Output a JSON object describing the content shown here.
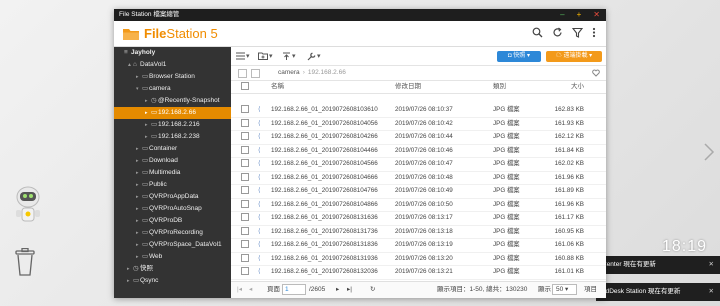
{
  "window": {
    "title": "File Station 檔案總管"
  },
  "app": {
    "logo_text_bold": "File",
    "logo_text_rest": "Station 5"
  },
  "colors": {
    "accent_orange": "#f08c00",
    "accent_blue": "#2d88d8",
    "sidebar_bg": "#333333",
    "selected_bg": "#e58b00"
  },
  "header_icons": [
    "search-icon",
    "refresh-icon",
    "filter-icon",
    "more-icon"
  ],
  "sidebar": {
    "items": [
      {
        "label": "Jayholy",
        "level": 0,
        "arrow": "",
        "icon": "≡",
        "selected": false,
        "head": true
      },
      {
        "label": "DataVol1",
        "level": 1,
        "arrow": "▲",
        "icon": "⌂",
        "selected": false
      },
      {
        "label": "Browser Station",
        "level": 2,
        "arrow": "▸",
        "icon": "▭",
        "selected": false
      },
      {
        "label": "camera",
        "level": 2,
        "arrow": "▾",
        "icon": "▭",
        "selected": false
      },
      {
        "label": "@Recently-Snapshot",
        "level": 3,
        "arrow": "▸",
        "icon": "◷",
        "selected": false
      },
      {
        "label": "192.168.2.66",
        "level": 3,
        "arrow": "▸",
        "icon": "▭",
        "selected": true
      },
      {
        "label": "192.168.2.216",
        "level": 3,
        "arrow": "▸",
        "icon": "▭",
        "selected": false
      },
      {
        "label": "192.168.2.238",
        "level": 3,
        "arrow": "▸",
        "icon": "▭",
        "selected": false
      },
      {
        "label": "Container",
        "level": 2,
        "arrow": "▸",
        "icon": "▭",
        "selected": false
      },
      {
        "label": "Download",
        "level": 2,
        "arrow": "▸",
        "icon": "▭",
        "selected": false
      },
      {
        "label": "Multimedia",
        "level": 2,
        "arrow": "▸",
        "icon": "▭",
        "selected": false
      },
      {
        "label": "Public",
        "level": 2,
        "arrow": "▸",
        "icon": "▭",
        "selected": false
      },
      {
        "label": "QVRProAppData",
        "level": 2,
        "arrow": "▸",
        "icon": "▭",
        "selected": false
      },
      {
        "label": "QVRProAutoSnap",
        "level": 2,
        "arrow": "▸",
        "icon": "▭",
        "selected": false
      },
      {
        "label": "QVRProDB",
        "level": 2,
        "arrow": "▸",
        "icon": "▭",
        "selected": false
      },
      {
        "label": "QVRProRecording",
        "level": 2,
        "arrow": "▸",
        "icon": "▭",
        "selected": false
      },
      {
        "label": "QVRProSpace_DataVol1",
        "level": 2,
        "arrow": "▸",
        "icon": "▭",
        "selected": false
      },
      {
        "label": "Web",
        "level": 2,
        "arrow": "▸",
        "icon": "▭",
        "selected": false
      },
      {
        "label": "快照",
        "level": 1,
        "arrow": "▸",
        "icon": "◷",
        "selected": false
      },
      {
        "label": "Qsync",
        "level": 1,
        "arrow": "▸",
        "icon": "▭",
        "selected": false
      }
    ]
  },
  "toolbar": {
    "snapshot_btn": "快照",
    "remote_mount_btn": "遠端掛載"
  },
  "path": {
    "root": "camera",
    "current": "192.168.2.66"
  },
  "columns": {
    "name": "名稱",
    "date": "修改日期",
    "type": "類別",
    "size": "大小"
  },
  "rows": [
    {
      "name": "192.168.2.66_01_2019072608103610",
      "date": "2019/07/26 08:10:37",
      "type": "JPG 檔案",
      "size": "162.83 KB"
    },
    {
      "name": "192.168.2.66_01_2019072608104056",
      "date": "2019/07/26 08:10:42",
      "type": "JPG 檔案",
      "size": "161.93 KB"
    },
    {
      "name": "192.168.2.66_01_2019072608104266",
      "date": "2019/07/26 08:10:44",
      "type": "JPG 檔案",
      "size": "162.12 KB"
    },
    {
      "name": "192.168.2.66_01_2019072608104466",
      "date": "2019/07/26 08:10:46",
      "type": "JPG 檔案",
      "size": "161.84 KB"
    },
    {
      "name": "192.168.2.66_01_2019072608104566",
      "date": "2019/07/26 08:10:47",
      "type": "JPG 檔案",
      "size": "162.02 KB"
    },
    {
      "name": "192.168.2.66_01_2019072608104666",
      "date": "2019/07/26 08:10:48",
      "type": "JPG 檔案",
      "size": "161.96 KB"
    },
    {
      "name": "192.168.2.66_01_2019072608104766",
      "date": "2019/07/26 08:10:49",
      "type": "JPG 檔案",
      "size": "161.89 KB"
    },
    {
      "name": "192.168.2.66_01_2019072608104866",
      "date": "2019/07/26 08:10:50",
      "type": "JPG 檔案",
      "size": "161.96 KB"
    },
    {
      "name": "192.168.2.66_01_2019072608131636",
      "date": "2019/07/26 08:13:17",
      "type": "JPG 檔案",
      "size": "161.17 KB"
    },
    {
      "name": "192.168.2.66_01_2019072608131736",
      "date": "2019/07/26 08:13:18",
      "type": "JPG 檔案",
      "size": "160.95 KB"
    },
    {
      "name": "192.168.2.66_01_2019072608131836",
      "date": "2019/07/26 08:13:19",
      "type": "JPG 檔案",
      "size": "161.06 KB"
    },
    {
      "name": "192.168.2.66_01_2019072608131936",
      "date": "2019/07/26 08:13:20",
      "type": "JPG 檔案",
      "size": "160.88 KB"
    },
    {
      "name": "192.168.2.66_01_2019072608132036",
      "date": "2019/07/26 08:13:21",
      "type": "JPG 檔案",
      "size": "161.01 KB"
    }
  ],
  "footer": {
    "page_label": "頁面",
    "page_value": "1",
    "page_total": "/2605",
    "display_items": "顯示項目：1-50, 總共：130230",
    "show_label": "顯示",
    "show_value": "50",
    "show_unit": "項目"
  },
  "desktop": {
    "clock": "18:19",
    "notice1": "Center 現在有更新",
    "notice2": "ridDesk Station 現在有更新"
  }
}
